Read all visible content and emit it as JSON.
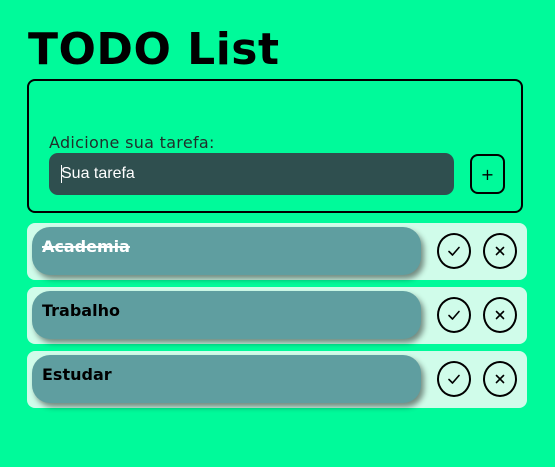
{
  "app": {
    "title": "TODO List"
  },
  "form": {
    "label": "Adicione sua tarefa:",
    "input_value": "",
    "input_placeholder": "Sua tarefa",
    "add_button_label": "+"
  },
  "todos": [
    {
      "label": "Academia",
      "completed": true
    },
    {
      "label": "Trabalho",
      "completed": false
    },
    {
      "label": "Estudar",
      "completed": false
    }
  ],
  "icons": {
    "complete": "check-icon",
    "remove": "close-icon"
  },
  "colors": {
    "background": "#00fa9a",
    "input_background": "#2f4f4f",
    "todo_pill": "#5f9ea0",
    "todo_row": "#d0fcea",
    "completed_text": "#ffffff"
  }
}
